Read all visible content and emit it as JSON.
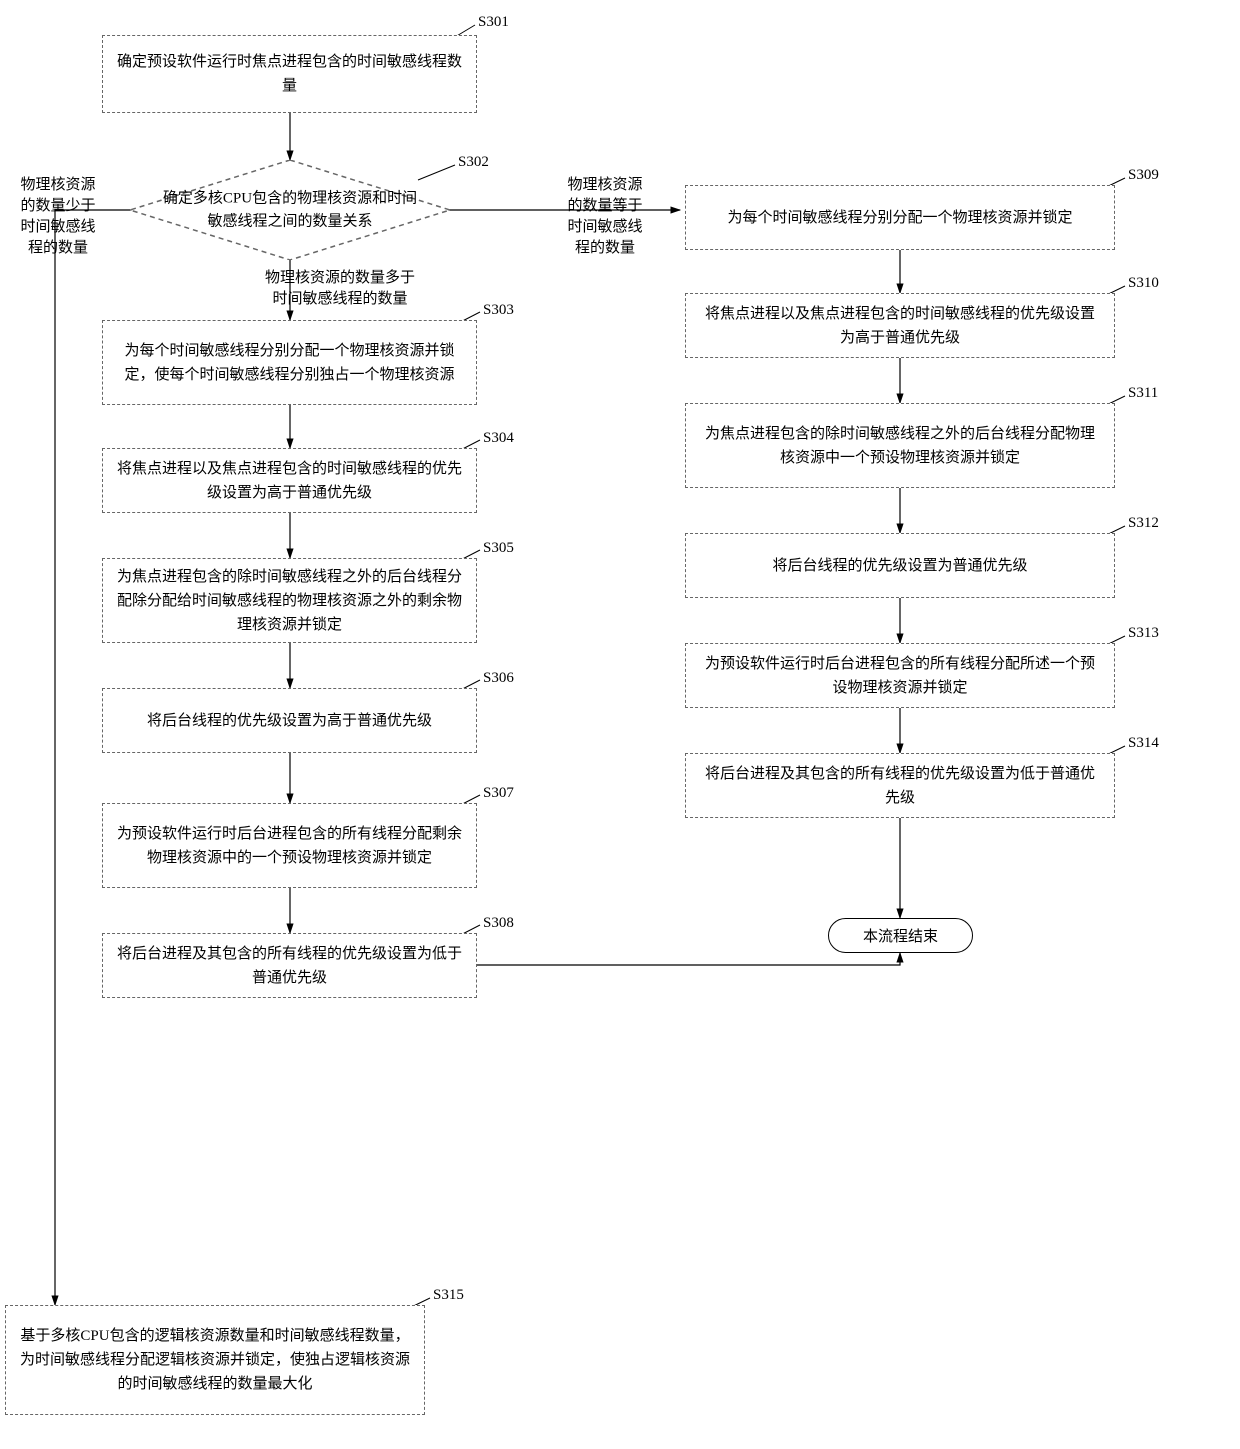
{
  "nodes": {
    "s301": {
      "label": "S301",
      "text": "确定预设软件运行时焦点进程包含的时间敏感线程数量"
    },
    "s302": {
      "label": "S302",
      "text": "确定多核CPU包含的物理核资源和时间敏感线程之间的数量关系"
    },
    "s303": {
      "label": "S303",
      "text": "为每个时间敏感线程分别分配一个物理核资源并锁定，使每个时间敏感线程分别独占一个物理核资源"
    },
    "s304": {
      "label": "S304",
      "text": "将焦点进程以及焦点进程包含的时间敏感线程的优先级设置为高于普通优先级"
    },
    "s305": {
      "label": "S305",
      "text": "为焦点进程包含的除时间敏感线程之外的后台线程分配除分配给时间敏感线程的物理核资源之外的剩余物理核资源并锁定"
    },
    "s306": {
      "label": "S306",
      "text": "将后台线程的优先级设置为高于普通优先级"
    },
    "s307": {
      "label": "S307",
      "text": "为预设软件运行时后台进程包含的所有线程分配剩余物理核资源中的一个预设物理核资源并锁定"
    },
    "s308": {
      "label": "S308",
      "text": "将后台进程及其包含的所有线程的优先级设置为低于普通优先级"
    },
    "s309": {
      "label": "S309",
      "text": "为每个时间敏感线程分别分配一个物理核资源并锁定"
    },
    "s310": {
      "label": "S310",
      "text": "将焦点进程以及焦点进程包含的时间敏感线程的优先级设置为高于普通优先级"
    },
    "s311": {
      "label": "S311",
      "text": "为焦点进程包含的除时间敏感线程之外的后台线程分配物理核资源中一个预设物理核资源并锁定"
    },
    "s312": {
      "label": "S312",
      "text": "将后台线程的优先级设置为普通优先级"
    },
    "s313": {
      "label": "S313",
      "text": "为预设软件运行时后台进程包含的所有线程分配所述一个预设物理核资源并锁定"
    },
    "s314": {
      "label": "S314",
      "text": "将后台进程及其包含的所有线程的优先级设置为低于普通优先级"
    },
    "s315": {
      "label": "S315",
      "text": "基于多核CPU包含的逻辑核资源数量和时间敏感线程数量，为时间敏感线程分配逻辑核资源并锁定，使独占逻辑核资源的时间敏感线程的数量最大化"
    }
  },
  "edges": {
    "left": "物理核资源的数量少于时间敏感线程的数量",
    "down": "物理核资源的数量多于时间敏感线程的数量",
    "right": "物理核资源的数量等于时间敏感线程的数量"
  },
  "terminator": "本流程结束"
}
